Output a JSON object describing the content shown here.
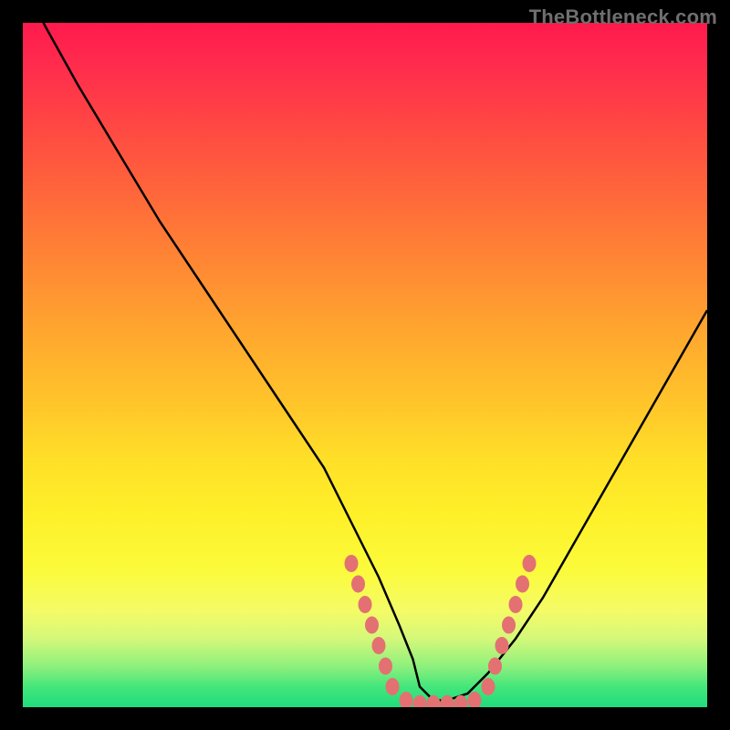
{
  "watermark": "TheBottleneck.com",
  "chart_data": {
    "type": "line",
    "title": "",
    "xlabel": "",
    "ylabel": "",
    "xlim": [
      0,
      100
    ],
    "ylim": [
      0,
      100
    ],
    "grid": false,
    "series": [
      {
        "name": "curve",
        "x": [
          3,
          8,
          14,
          20,
          26,
          32,
          38,
          44,
          48,
          52,
          55,
          57,
          58,
          60,
          62,
          65,
          68,
          72,
          76,
          80,
          84,
          88,
          92,
          96,
          100
        ],
        "y": [
          100,
          91,
          81,
          71,
          62,
          53,
          44,
          35,
          27,
          19,
          12,
          7,
          3,
          1,
          1,
          2,
          5,
          10,
          16,
          23,
          30,
          37,
          44,
          51,
          58
        ]
      }
    ],
    "annotations": {
      "dot_cluster": {
        "name": "highlight-dots",
        "color": "#e37172",
        "points": [
          {
            "x": 48,
            "y": 21
          },
          {
            "x": 49,
            "y": 18
          },
          {
            "x": 50,
            "y": 15
          },
          {
            "x": 51,
            "y": 12
          },
          {
            "x": 52,
            "y": 9
          },
          {
            "x": 53,
            "y": 6
          },
          {
            "x": 54,
            "y": 3
          },
          {
            "x": 56,
            "y": 1
          },
          {
            "x": 58,
            "y": 0.5
          },
          {
            "x": 60,
            "y": 0.5
          },
          {
            "x": 62,
            "y": 0.5
          },
          {
            "x": 64,
            "y": 0.5
          },
          {
            "x": 66,
            "y": 1
          },
          {
            "x": 68,
            "y": 3
          },
          {
            "x": 69,
            "y": 6
          },
          {
            "x": 70,
            "y": 9
          },
          {
            "x": 71,
            "y": 12
          },
          {
            "x": 72,
            "y": 15
          },
          {
            "x": 73,
            "y": 18
          },
          {
            "x": 74,
            "y": 21
          }
        ]
      }
    }
  }
}
